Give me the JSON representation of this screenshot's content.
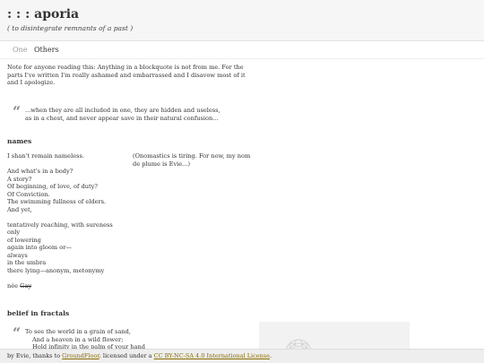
{
  "header": {
    "title": ": : : aporia",
    "subtitle": "( to disintegrate remnants of a past )"
  },
  "nav": {
    "tabs": [
      {
        "label": "One",
        "active": false
      },
      {
        "label": "Others",
        "active": true
      }
    ]
  },
  "note": "Note for anyone reading this: Anything in a blockquote is not from me. For the parts I've written I'm really ashamed and embarrassed and I disavow most of it and I apologize.",
  "quote1": {
    "mark": "“",
    "lines": [
      "...when they are all included in one, they are hidden and useless,",
      "as in a chest, and never appear save in their natural confusion..."
    ]
  },
  "names": {
    "heading": "names",
    "aside": "(Onomastics is tiring. For now, my nom de plume is Evie...)",
    "lines": [
      "I shan't remain nameless.",
      "",
      "And what's in a body?",
      "A story?",
      "Of beginning, of love, of duty?",
      "Of Conviction.",
      "The swimming fullness of elders.",
      "And yet,",
      "",
      "tentatively reaching, with sureness",
      "only",
      "of lowering",
      "again into gloom or—",
      "always",
      "in the umbra",
      "there lying—anonym, metonymy",
      ""
    ],
    "nee_prefix": "née ",
    "nee_struck": "Gay"
  },
  "fractals": {
    "heading": "belief in fractals",
    "mark": "“",
    "lines": [
      "To see the world in a grain of sand,",
      "And a heaven in a wild flower;",
      "Hold infinity in the palm of your hand"
    ]
  },
  "footer": {
    "prefix": "by Evie, thanks to ",
    "link1": "GroundFloor",
    "middle": ". licensed under a ",
    "link2": "CC BY-NC-SA 4.0 International License",
    "suffix": "."
  }
}
